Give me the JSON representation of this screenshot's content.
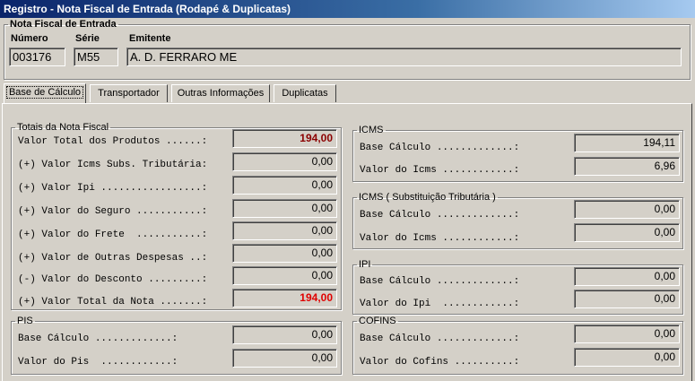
{
  "window": {
    "title": "Registro - Nota Fiscal de Entrada (Rodapé & Duplicatas)"
  },
  "header": {
    "group_title": "Nota Fiscal de Entrada",
    "numero_label": "Número",
    "numero_value": "003176",
    "serie_label": "Série",
    "serie_value": "M55",
    "emitente_label": "Emitente",
    "emitente_value": "A. D. FERRARO ME"
  },
  "tabs": [
    {
      "label": "Base de Cálculo",
      "active": true
    },
    {
      "label": "Transportador",
      "active": false
    },
    {
      "label": "Outras Informações",
      "active": false
    },
    {
      "label": "Duplicatas",
      "active": false
    }
  ],
  "totais": {
    "title": "Totais da Nota Fiscal",
    "rows": [
      {
        "label": "Valor Total dos Produtos ......:",
        "value": "194,00"
      },
      {
        "label": "(+) Valor Icms Subs. Tributária:",
        "value": "0,00"
      },
      {
        "label": "(+) Valor Ipi .................:",
        "value": "0,00"
      },
      {
        "label": "(+) Valor do Seguro ...........:",
        "value": "0,00"
      },
      {
        "label": "(+) Valor do Frete  ...........:",
        "value": "0,00"
      },
      {
        "label": "(+) Valor de Outras Despesas ..:",
        "value": "0,00"
      },
      {
        "label": "(-) Valor do Desconto .........:",
        "value": "0,00"
      },
      {
        "label": "(+) Valor Total da Nota .......:",
        "value": "194,00"
      }
    ]
  },
  "pis": {
    "title": "PIS",
    "rows": [
      {
        "label": "Base Cálculo .............:",
        "value": "0,00"
      },
      {
        "label": "Valor do Pis  ............:",
        "value": "0,00"
      }
    ]
  },
  "icms": {
    "title": "ICMS",
    "rows": [
      {
        "label": "Base Cálculo .............:",
        "value": "194,11"
      },
      {
        "label": "Valor do Icms ............:",
        "value": "6,96"
      }
    ]
  },
  "icms_st": {
    "title": "ICMS ( Substituição Tributária )",
    "rows": [
      {
        "label": "Base Cálculo .............:",
        "value": "0,00"
      },
      {
        "label": "Valor do Icms ............:",
        "value": "0,00"
      }
    ]
  },
  "ipi": {
    "title": "IPI",
    "rows": [
      {
        "label": "Base Cálculo .............:",
        "value": "0,00"
      },
      {
        "label": "Valor do Ipi  ............:",
        "value": "0,00"
      }
    ]
  },
  "cofins": {
    "title": "COFINS",
    "rows": [
      {
        "label": "Base Cálculo .............:",
        "value": "0,00"
      },
      {
        "label": "Valor do Cofins ..........:",
        "value": "0,00"
      }
    ]
  },
  "colors": {
    "title_bar": "#0a246a",
    "total_produtos": "#8b0000",
    "total_nota": "#e00000"
  }
}
